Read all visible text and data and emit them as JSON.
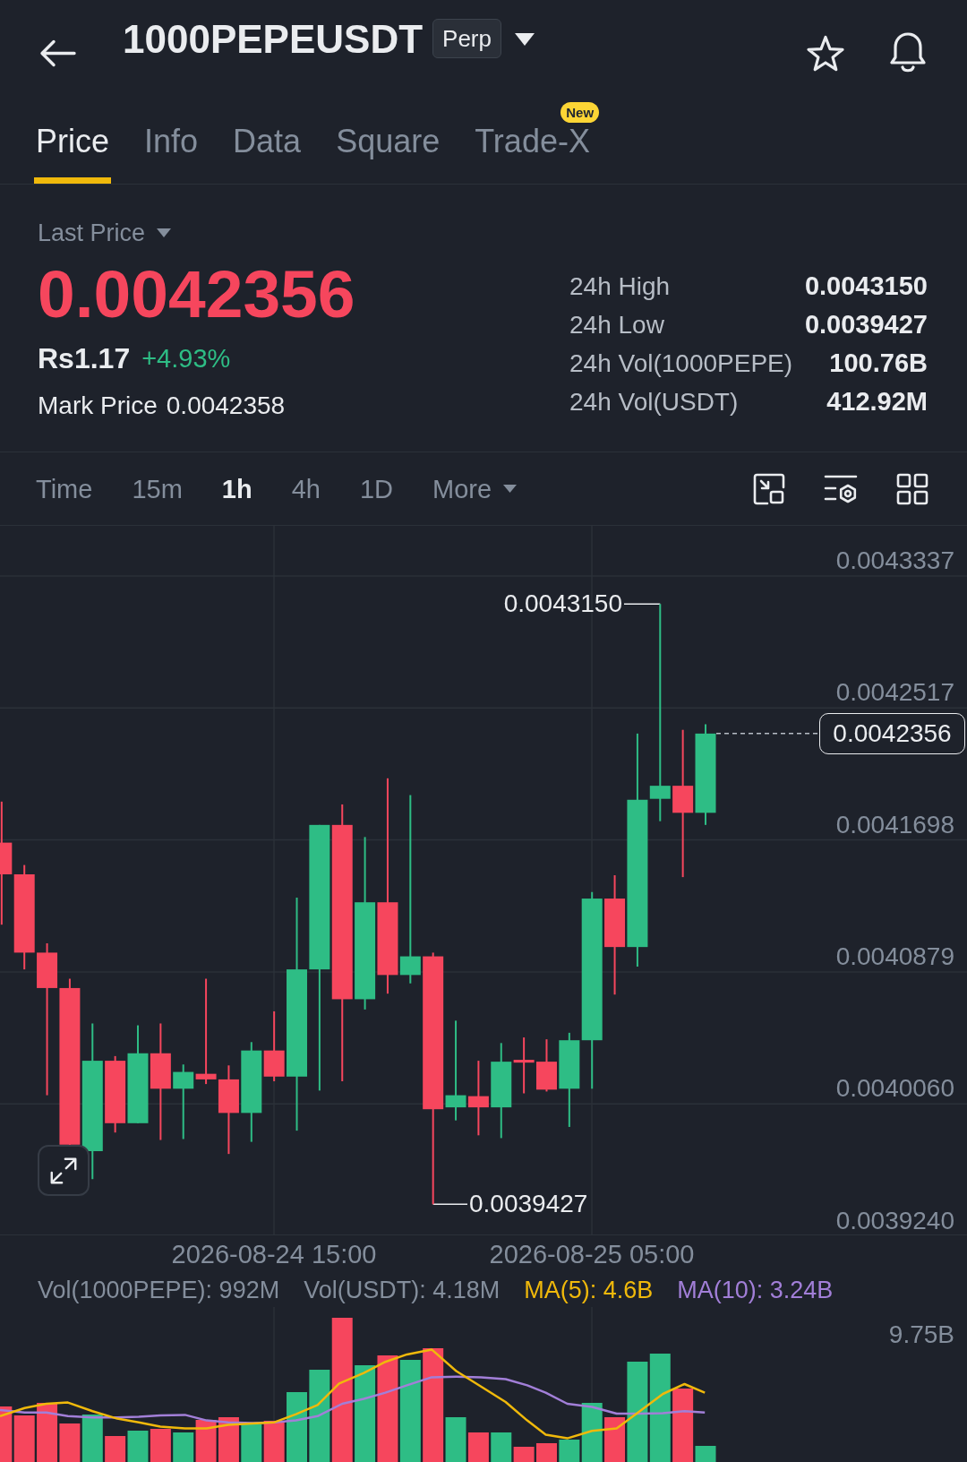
{
  "header": {
    "symbol": "1000PEPEUSDT",
    "contract": "Perp"
  },
  "tabs": [
    {
      "label": "Price",
      "selected": true
    },
    {
      "label": "Info",
      "selected": false
    },
    {
      "label": "Data",
      "selected": false
    },
    {
      "label": "Square",
      "selected": false
    },
    {
      "label": "Trade-X",
      "selected": false,
      "badge": "New"
    }
  ],
  "price": {
    "label": "Last Price",
    "last": {
      "value": "0.0042356",
      "rising": false
    },
    "fiat": "Rs1.17",
    "change": {
      "value": "+4.93%",
      "rising": true
    },
    "mark_label": "Mark Price",
    "mark_value": "0.0042358",
    "stats": [
      {
        "label": "24h High",
        "value": "0.0043150"
      },
      {
        "label": "24h Low",
        "value": "0.0039427"
      },
      {
        "label": "24h Vol(1000PEPE)",
        "value": "100.76B"
      },
      {
        "label": "24h Vol(USDT)",
        "value": "412.92M"
      }
    ]
  },
  "intervals": [
    {
      "label": "Time",
      "kind": "option",
      "selected": false
    },
    {
      "label": "15m",
      "kind": "option",
      "selected": false
    },
    {
      "label": "1h",
      "kind": "option",
      "selected": true
    },
    {
      "label": "4h",
      "kind": "option",
      "selected": false
    },
    {
      "label": "1D",
      "kind": "option",
      "selected": false
    },
    {
      "label": "More",
      "kind": "menu",
      "selected": false
    }
  ],
  "chart": {
    "price_axis": [
      "0.0043337",
      "0.0042517",
      "0.0041698",
      "0.0040879",
      "0.0040060",
      "0.0039240"
    ],
    "high_marker": "0.0043150",
    "low_marker": "0.0039427",
    "current_price": "0.0042356",
    "time_axis": [
      "2026-08-24 15:00",
      "2026-08-25 05:00"
    ]
  },
  "volume": {
    "legend": [
      {
        "text": "Vol(1000PEPE): 992M",
        "color": "#848e9c"
      },
      {
        "text": "Vol(USDT): 4.18M",
        "color": "#848e9c"
      },
      {
        "text": "MA(5): 4.6B",
        "color": "#f0b90b"
      },
      {
        "text": "MA(10): 3.24B",
        "color": "#a27fd8"
      }
    ],
    "axis_label": "9.75B"
  }
}
